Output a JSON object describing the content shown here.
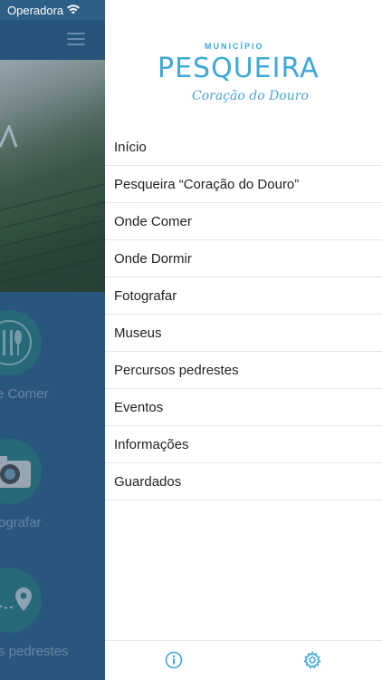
{
  "status_bar": {
    "carrier": "Operadora",
    "wifi_icon": "wifi-icon"
  },
  "background": {
    "features": [
      {
        "label": "e Comer",
        "icon": "restaurant-icon"
      },
      {
        "label": "ografar",
        "icon": "camera-icon"
      },
      {
        "label": "s pedrestes",
        "icon": "map-pin-icon"
      }
    ]
  },
  "drawer": {
    "logo": {
      "top_text": "MUNICÍPIO",
      "main_text": "PESQUEIRA",
      "script_text": "Coração do Douro"
    },
    "menu": [
      {
        "label": "Início"
      },
      {
        "label": "Pesqueira “Coração do Douro”"
      },
      {
        "label": "Onde Comer"
      },
      {
        "label": "Onde Dormir"
      },
      {
        "label": "Fotografar"
      },
      {
        "label": "Museus"
      },
      {
        "label": "Percursos pedrestes"
      },
      {
        "label": "Eventos"
      },
      {
        "label": "Informações"
      },
      {
        "label": "Guardados"
      }
    ],
    "bottom_bar": {
      "info_icon": "info-icon",
      "settings_icon": "gear-icon"
    }
  },
  "colors": {
    "accent": "#3ea8d8",
    "app_background": "#2e5f86",
    "feature_circle": "#2b7a80"
  }
}
